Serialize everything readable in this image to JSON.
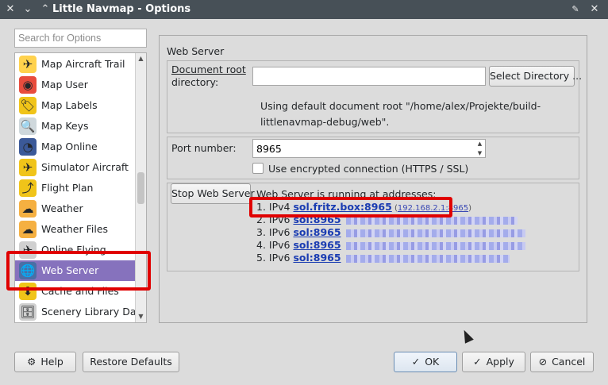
{
  "window": {
    "title": "Little Navmap - Options",
    "controls": {
      "close": "✕",
      "menu": "⌄",
      "pin": "📌",
      "close_right": "✕"
    }
  },
  "sidebar": {
    "search_placeholder": "Search for Options",
    "items": [
      {
        "label": "Map Aircraft Trail",
        "icon": "aircraft-trail-icon",
        "glyph": "✈"
      },
      {
        "label": "Map User",
        "icon": "map-user-icon",
        "glyph": "◉"
      },
      {
        "label": "Map Labels",
        "icon": "map-labels-icon",
        "glyph": "🏷"
      },
      {
        "label": "Map Keys",
        "icon": "map-keys-icon",
        "glyph": "🔍"
      },
      {
        "label": "Map Online",
        "icon": "map-online-icon",
        "glyph": "◔"
      },
      {
        "label": "Simulator Aircraft",
        "icon": "simulator-aircraft-icon",
        "glyph": "✈"
      },
      {
        "label": "Flight Plan",
        "icon": "flight-plan-icon",
        "glyph": "⤴"
      },
      {
        "label": "Weather",
        "icon": "weather-icon",
        "glyph": "☁"
      },
      {
        "label": "Weather Files",
        "icon": "weather-files-icon",
        "glyph": "☁"
      },
      {
        "label": "Online Flying",
        "icon": "online-flying-icon",
        "glyph": "✈"
      },
      {
        "label": "Web Server",
        "icon": "web-server-icon",
        "glyph": "🌐"
      },
      {
        "label": "Cache and Files",
        "icon": "cache-files-icon",
        "glyph": "⬇"
      },
      {
        "label": "Scenery Library Datab",
        "icon": "scenery-library-icon",
        "glyph": "🗄"
      }
    ],
    "selected_index": 10
  },
  "web_server": {
    "section_title": "Web Server",
    "doc_root_label_line1": "Document root",
    "doc_root_label_line2": "directory:",
    "doc_root_value": "",
    "select_directory_button": "Select Directory ...",
    "doc_root_info_line1": "Using default document root \"/home/alex/Projekte/build-",
    "doc_root_info_line2": "littlenavmap-debug/web\".",
    "port_label": "Port number:",
    "port_value": "8965",
    "encrypted_label": "Use encrypted connection (HTTPS / SSL)",
    "encrypted_checked": false,
    "stop_button": "Stop Web Server",
    "status_text": "Web Server is running at addresses:",
    "addresses": [
      {
        "prefix": "1. IPv4 ",
        "host": "sol.fritz.box:8965",
        "extra": "192.168.2.1:8965"
      },
      {
        "prefix": "2. IPv6 ",
        "host": "sol:8965",
        "extra": ""
      },
      {
        "prefix": "3. IPv6 ",
        "host": "sol:8965",
        "extra": ""
      },
      {
        "prefix": "4. IPv6 ",
        "host": "sol:8965",
        "extra": ""
      },
      {
        "prefix": "5. IPv6 ",
        "host": "sol:8965",
        "extra": ""
      }
    ]
  },
  "footer": {
    "help": "Help",
    "restore_defaults": "Restore Defaults",
    "ok": "OK",
    "apply": "Apply",
    "cancel": "Cancel"
  },
  "colors": {
    "selection": "#8672bd",
    "highlight": "#e00000",
    "link": "#1a3cb2"
  }
}
